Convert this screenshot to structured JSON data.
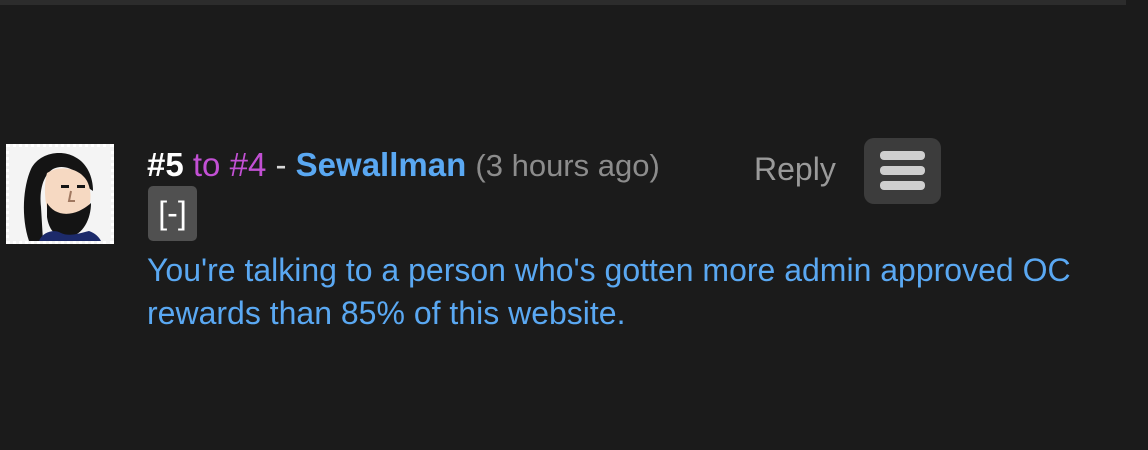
{
  "comment": {
    "number": "#5",
    "to_word": "to",
    "parent_number": "#4",
    "separator": "-",
    "username": "Sewallman",
    "timestamp": "(3 hours ago)",
    "reply_label": "Reply",
    "collapse_label": "[-]",
    "text": "You're talking to a person who's gotten more admin approved OC rewards than 85% of this website.",
    "avatar_icon": "user-avatar-icon",
    "menu_icon": "hamburger-menu-icon"
  },
  "colors": {
    "background": "#1b1b1b",
    "username": "#5aa8f2",
    "reply_reference": "#c250d4",
    "timestamp": "#8c8c8c",
    "body_text": "#5aa8f2"
  }
}
